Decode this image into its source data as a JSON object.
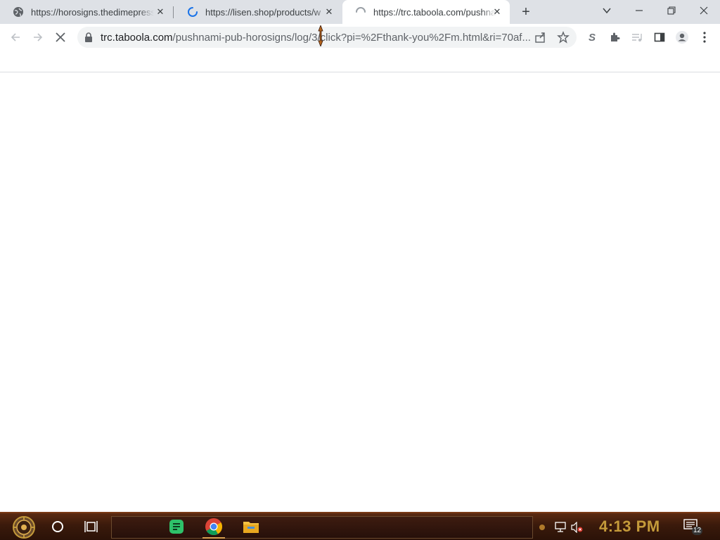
{
  "tabs": [
    {
      "title": "https://horosigns.thedimepress",
      "icon": "globe-icon"
    },
    {
      "title": "https://lisen.shop/products/w",
      "icon": "loading-spinner-icon"
    },
    {
      "title": "https://trc.taboola.com/pushna",
      "icon": "loading-spinner-icon",
      "active": true
    }
  ],
  "omnibox": {
    "host": "trc.taboola.com",
    "path": "/pushnami-pub-horosigns/log/3/click?pi=%2Fthank-you%2Fm.html&ri=70af..."
  },
  "taskbar": {
    "clock": "4:13 PM",
    "notification_count": "12"
  },
  "colors": {
    "tabstrip_bg": "#dee1e6",
    "taskbar_bg": "#3a1a0b",
    "clock_color": "#c49a3a"
  }
}
